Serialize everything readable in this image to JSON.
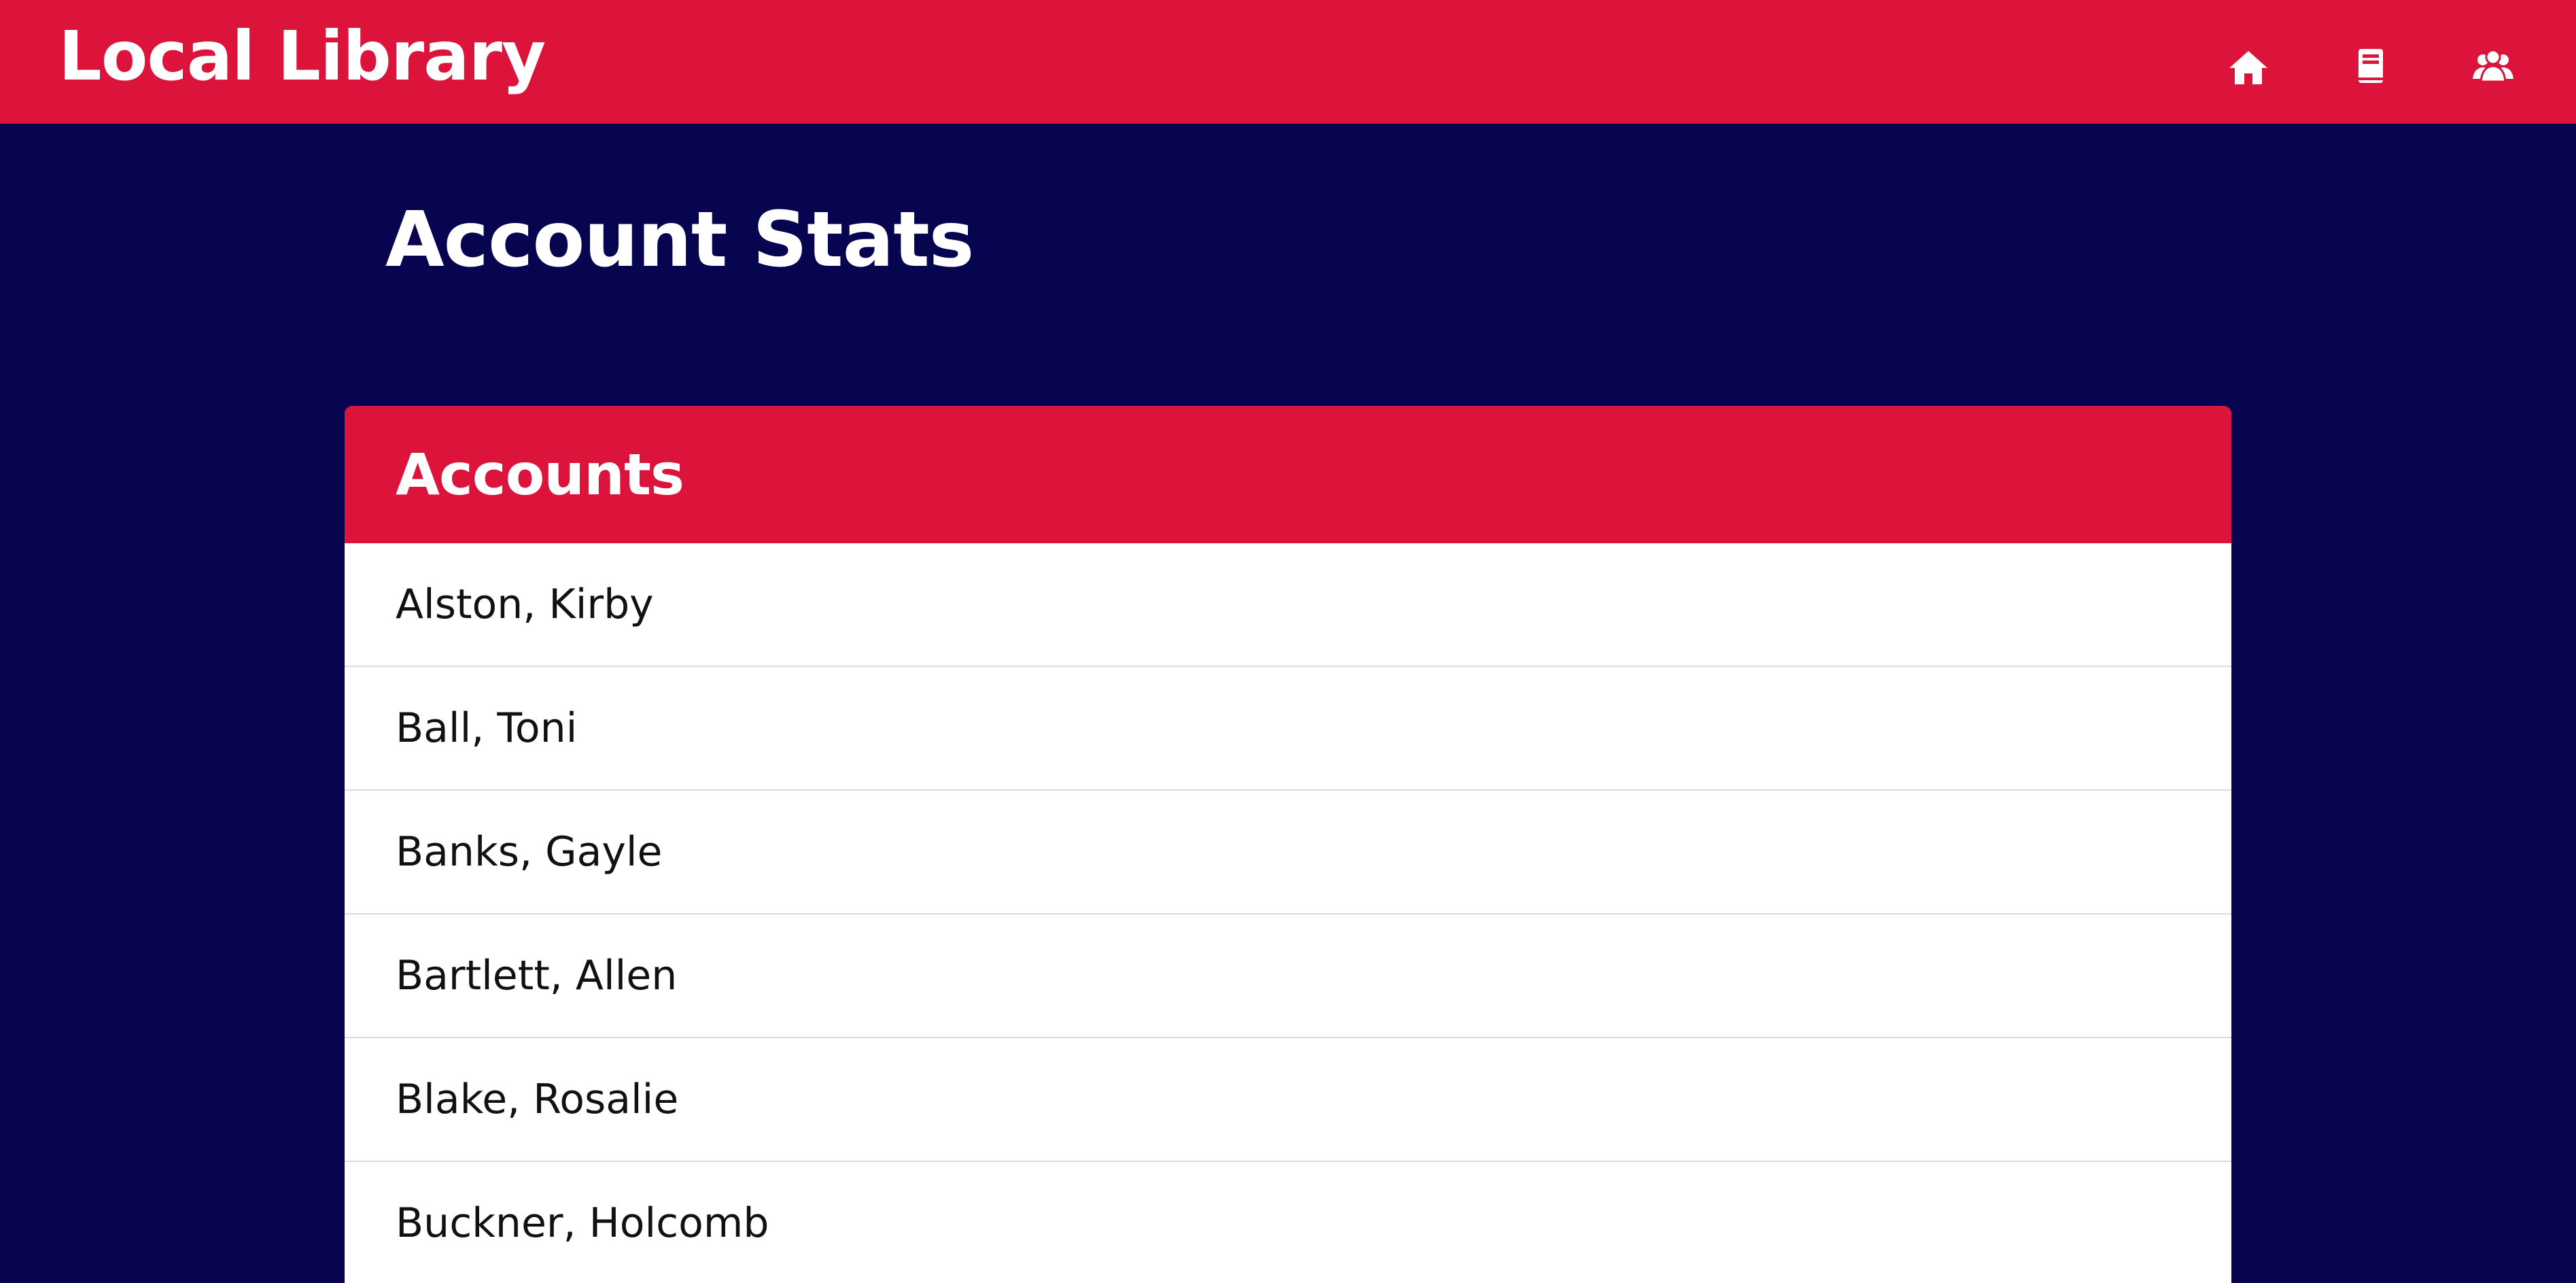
{
  "header": {
    "title": "Local Library",
    "nav": [
      {
        "icon": "home-icon",
        "label": "Home"
      },
      {
        "icon": "book-icon",
        "label": "Books"
      },
      {
        "icon": "users-icon",
        "label": "Accounts"
      }
    ]
  },
  "page": {
    "title": "Account Stats"
  },
  "accounts_card": {
    "title": "Accounts",
    "items": [
      {
        "name": "Alston, Kirby"
      },
      {
        "name": "Ball, Toni"
      },
      {
        "name": "Banks, Gayle"
      },
      {
        "name": "Bartlett, Allen"
      },
      {
        "name": "Blake, Rosalie"
      },
      {
        "name": "Buckner, Holcomb"
      }
    ]
  },
  "colors": {
    "primary": "#dc143c",
    "background": "#080550",
    "card": "#ffffff"
  }
}
